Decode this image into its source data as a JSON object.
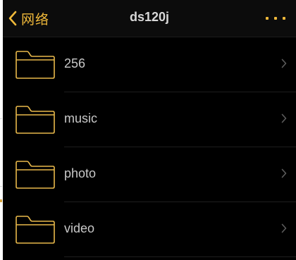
{
  "nav": {
    "back_label": "网络",
    "title": "ds120j",
    "more_icon": "ellipsis-icon",
    "accent_color": "#f0b93a"
  },
  "folders": [
    {
      "name": "256",
      "icon": "folder-icon"
    },
    {
      "name": "music",
      "icon": "folder-icon"
    },
    {
      "name": "photo",
      "icon": "folder-icon"
    },
    {
      "name": "video",
      "icon": "folder-icon"
    }
  ]
}
